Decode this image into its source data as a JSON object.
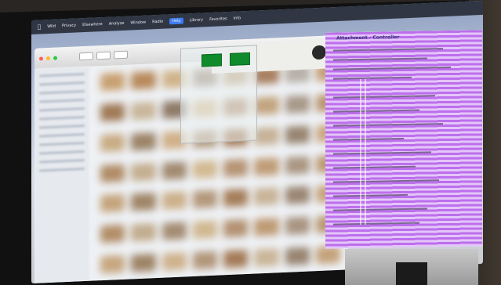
{
  "menubar": {
    "items": [
      "Wild",
      "Privacy",
      "Elsewhere",
      "Analyze",
      "Window",
      "Radio",
      "Help",
      "Library",
      "Favorites",
      "Info"
    ]
  },
  "panel": {
    "title": "Attachment - Controller"
  },
  "colors": {
    "purple_overlay": "#aa46e6",
    "green_button": "#0f8a2c",
    "menubar": "#1e232d"
  }
}
